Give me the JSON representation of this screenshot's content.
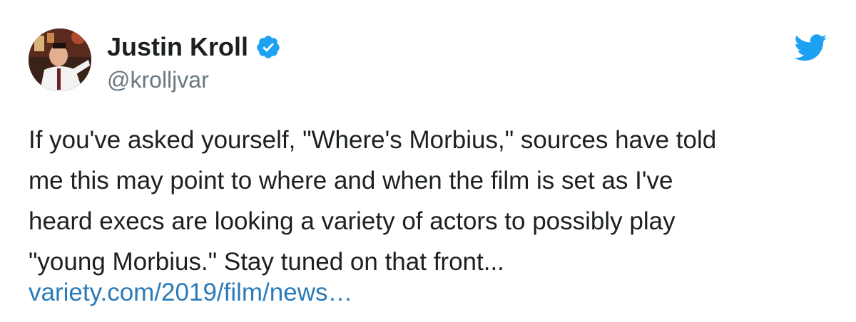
{
  "tweet": {
    "author_name": "Justin Kroll",
    "author_handle": "@krolljvar",
    "verified_icon": "verified-badge-icon",
    "platform_icon": "twitter-bird-icon",
    "text_lines": [
      "If you've asked yourself, \"Where's Morbius,\" sources have told",
      "me this may point to where and when the film is set as I've",
      "heard execs are looking a variety of actors to possibly play",
      "\"young Morbius.\" Stay tuned on that front..."
    ],
    "link_text": "variety.com/2019/film/news…"
  },
  "colors": {
    "text": "#1c2022",
    "handle": "#697882",
    "link": "#2b7bb9",
    "twitter_blue": "#1da1f2"
  }
}
